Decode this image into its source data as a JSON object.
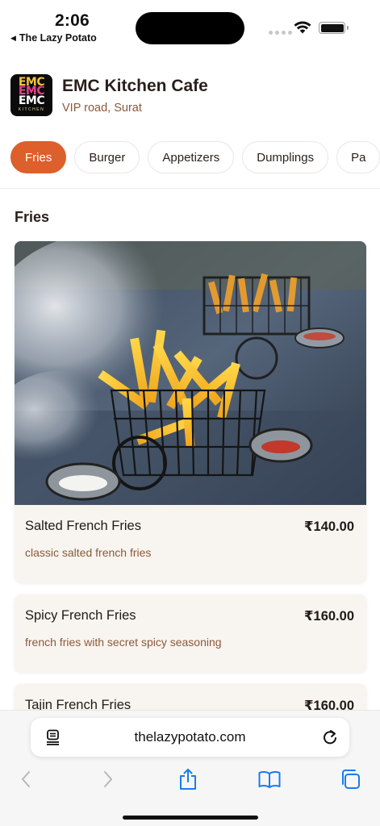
{
  "status_bar": {
    "time": "2:06",
    "back_app": "The Lazy Potato"
  },
  "restaurant": {
    "logo": {
      "line1": "EMC",
      "line2": "EMC",
      "line3": "EMC",
      "line4": "KITCHEN"
    },
    "name": "EMC Kitchen Cafe",
    "location": "VIP road, Surat"
  },
  "categories": [
    {
      "label": "Fries",
      "active": true
    },
    {
      "label": "Burger",
      "active": false
    },
    {
      "label": "Appetizers",
      "active": false
    },
    {
      "label": "Dumplings",
      "active": false
    },
    {
      "label": "Pa",
      "active": false
    }
  ],
  "section": {
    "title": "Fries"
  },
  "items": [
    {
      "name": "Salted French Fries",
      "price": "₹140.00",
      "description": "classic salted french fries"
    },
    {
      "name": "Spicy French Fries",
      "price": "₹160.00",
      "description": "french fries with secret spicy seasoning"
    },
    {
      "name": "Tajin French Fries",
      "price": "₹160.00",
      "description": ""
    }
  ],
  "browser": {
    "url": "thelazypotato.com",
    "icons": [
      "reader-icon",
      "reload-icon",
      "back-icon",
      "forward-icon",
      "share-icon",
      "bookmarks-icon",
      "tabs-icon"
    ]
  },
  "colors": {
    "accent": "#dd5f2c",
    "card_bg": "#f8f4ef",
    "desc_text": "#8a5a3b"
  }
}
